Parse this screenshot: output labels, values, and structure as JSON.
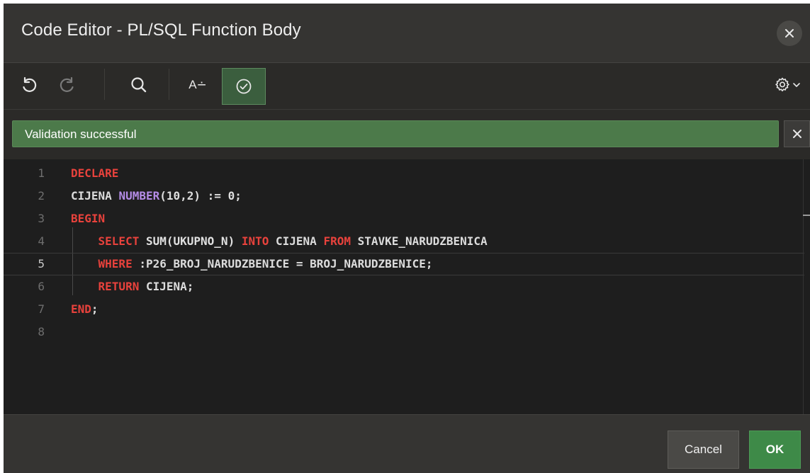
{
  "dialog": {
    "title": "Code Editor - PL/SQL Function Body"
  },
  "toolbar": {
    "undo_icon": "undo-icon",
    "redo_icon": "redo-icon",
    "search_icon": "search-icon",
    "autocomplete_label": "A∸",
    "validate_icon": "check-circle-icon",
    "settings_icon": "gear-icon"
  },
  "validation": {
    "message": "Validation successful"
  },
  "editor": {
    "current_line": 5,
    "lines": [
      {
        "n": "1",
        "tokens": [
          {
            "t": "DECLARE",
            "c": "kw"
          }
        ]
      },
      {
        "n": "2",
        "tokens": [
          {
            "t": "CIJENA ",
            "c": "id"
          },
          {
            "t": "NUMBER",
            "c": "ty"
          },
          {
            "t": "(10,2) := 0;",
            "c": "num"
          }
        ]
      },
      {
        "n": "3",
        "tokens": [
          {
            "t": "BEGIN",
            "c": "kw"
          }
        ]
      },
      {
        "n": "4",
        "tokens": [
          {
            "t": "    ",
            "c": "id"
          },
          {
            "t": "SELECT ",
            "c": "kw"
          },
          {
            "t": "SUM(UKUPNO_N) ",
            "c": "fn"
          },
          {
            "t": "INTO ",
            "c": "kw"
          },
          {
            "t": "CIJENA ",
            "c": "id"
          },
          {
            "t": "FROM ",
            "c": "kw"
          },
          {
            "t": "STAVKE_NARUDZBENICA",
            "c": "id"
          }
        ]
      },
      {
        "n": "5",
        "tokens": [
          {
            "t": "    ",
            "c": "id"
          },
          {
            "t": "WHERE ",
            "c": "kw"
          },
          {
            "t": ":P26_BROJ_NARUDZBENICE = BROJ_NARUDZBENICE;",
            "c": "id"
          }
        ]
      },
      {
        "n": "6",
        "tokens": [
          {
            "t": "    ",
            "c": "id"
          },
          {
            "t": "RETURN ",
            "c": "kw"
          },
          {
            "t": "CIJENA;",
            "c": "id"
          }
        ]
      },
      {
        "n": "7",
        "tokens": [
          {
            "t": "END",
            "c": "kw"
          },
          {
            "t": ";",
            "c": "id"
          }
        ]
      },
      {
        "n": "8",
        "tokens": []
      }
    ]
  },
  "footer": {
    "cancel_label": "Cancel",
    "ok_label": "OK"
  },
  "colors": {
    "keyword": "#e8423c",
    "type": "#b48ce6",
    "success": "#4c7a4a",
    "ok_button": "#3e8a48"
  }
}
